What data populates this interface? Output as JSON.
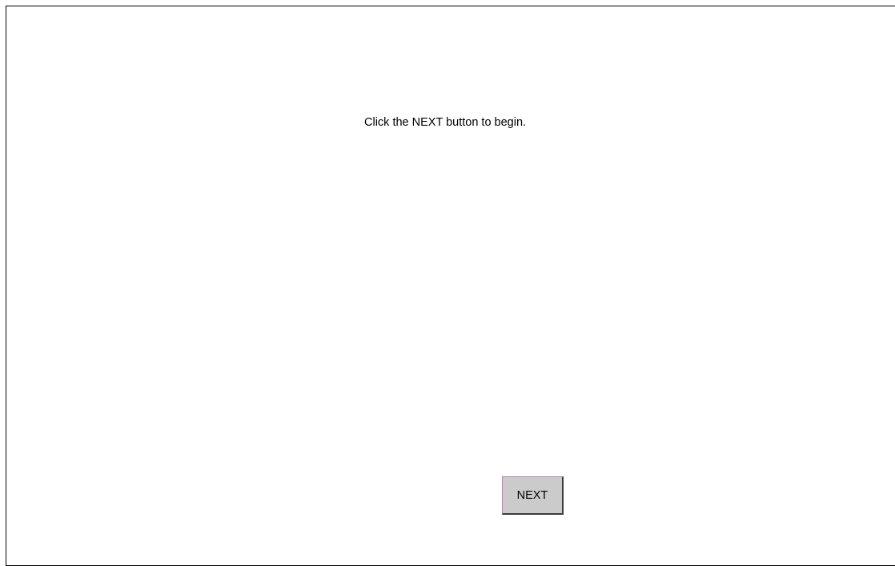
{
  "instruction_text": "Click the NEXT button to begin.",
  "next_button": {
    "label": "NEXT"
  },
  "colors": {
    "background": "#ffffff",
    "button_face": "#cbcbcb",
    "border": "#000000"
  }
}
